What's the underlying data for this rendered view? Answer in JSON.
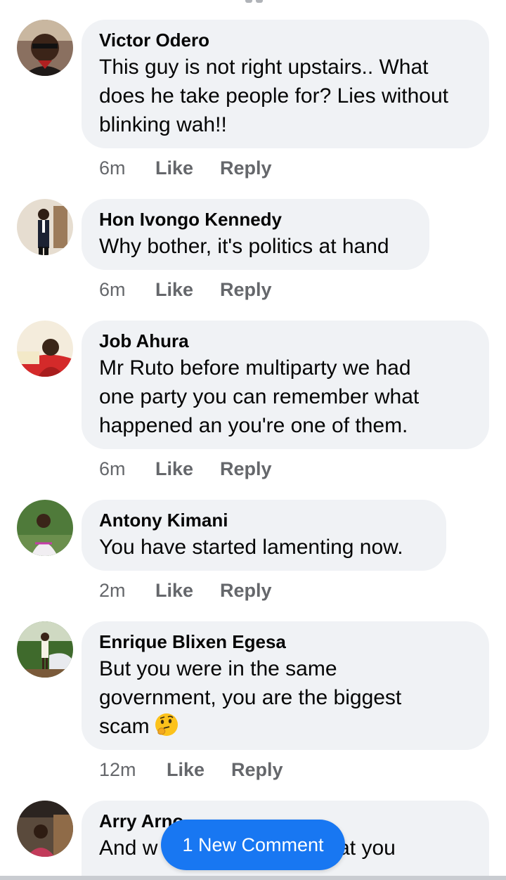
{
  "comments": [
    {
      "author": "Victor Odero",
      "lines": [
        "This guy is not right upstairs.. What",
        "does he take people for? Lies without",
        "blinking wah!!"
      ],
      "time": "6m",
      "like": "Like",
      "reply": "Reply"
    },
    {
      "author": "Hon Ivongo Kennedy",
      "lines": [
        "Why bother, it's politics at hand"
      ],
      "time": "6m",
      "like": "Like",
      "reply": "Reply"
    },
    {
      "author": "Job Ahura",
      "lines": [
        "Mr Ruto before multiparty we had",
        "one party you can remember what",
        "happened an you're one of them."
      ],
      "time": "6m",
      "like": "Like",
      "reply": "Reply"
    },
    {
      "author": "Antony Kimani",
      "lines": [
        "You have started lamenting now."
      ],
      "time": "2m",
      "like": "Like",
      "reply": "Reply"
    },
    {
      "author": "Enrique Blixen Egesa",
      "lines": [
        "But you were in the same",
        "government,  you are the biggest",
        "scam"
      ],
      "emoji": "thinking-face-icon",
      "time": "12m",
      "like": "Like",
      "reply": "Reply"
    },
    {
      "author": "Arry Arno",
      "lines": [
        "And w                         s that you"
      ]
    }
  ],
  "new_comment_label": "1 New Comment",
  "colors": {
    "bubble": "#f0f2f5",
    "meta_text": "#65676b",
    "accent": "#1877f2"
  }
}
